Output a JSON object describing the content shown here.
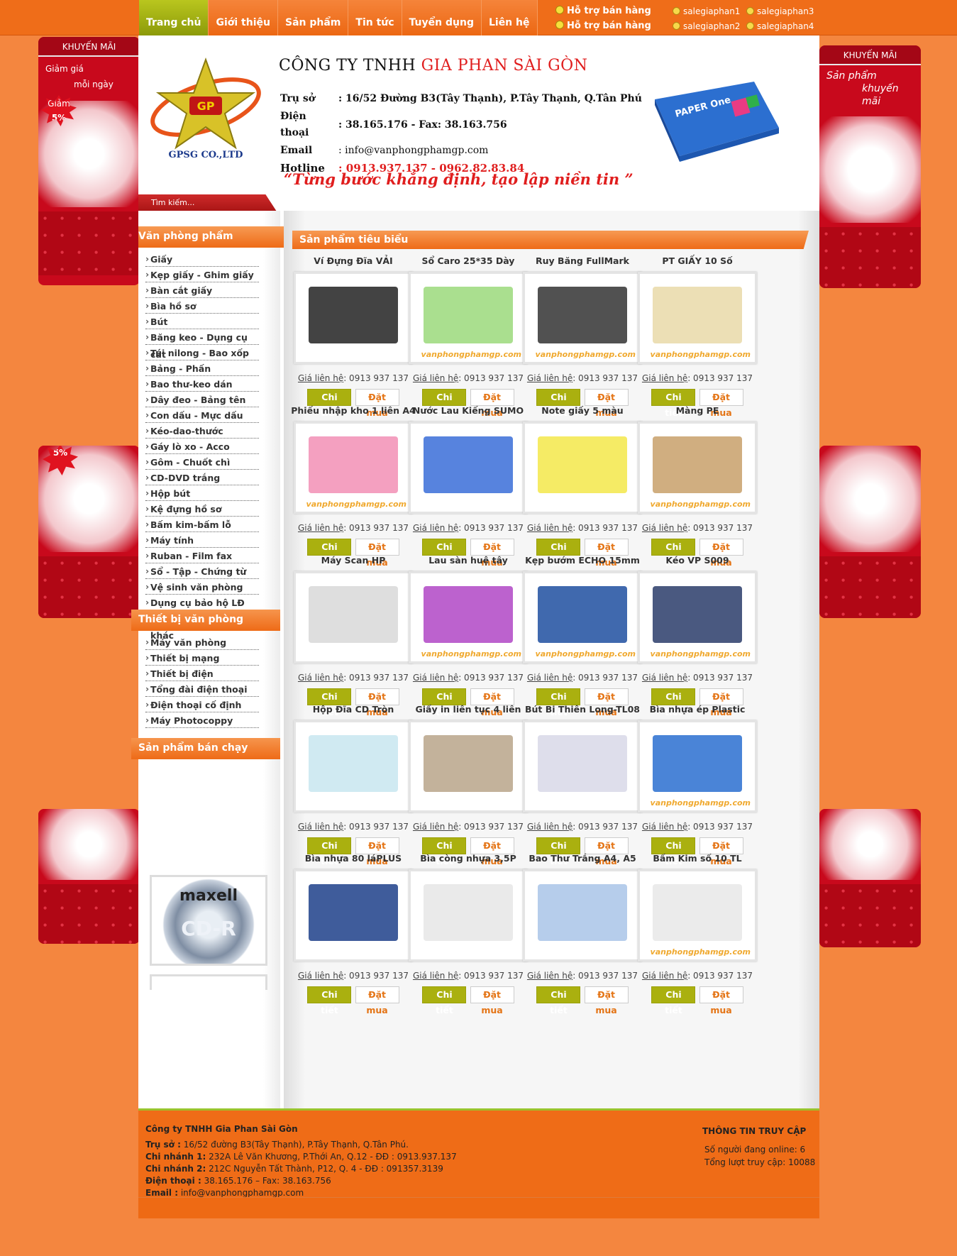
{
  "nav": {
    "items": [
      "Trang chủ",
      "Giới thiệu",
      "Sản phẩm",
      "Tin tức",
      "Tuyển dụng",
      "Liên hệ"
    ]
  },
  "support": {
    "label1": "Hỗ trợ bán hàng",
    "label2": "Hỗ trợ bán hàng",
    "accounts": [
      "salegiaphan1",
      "salegiaphan3",
      "salegiaphan2",
      "salegiaphan4"
    ]
  },
  "promo_left": {
    "title": "KHUYẾN MÃI",
    "text1": "Giảm giá",
    "text2": "mỗi ngày",
    "badge1": "Giảm",
    "badge2": "5%",
    "badge3": "5%"
  },
  "promo_right": {
    "title": "KHUYẾN MÃI",
    "text1": "Sản phẩm",
    "text2": "khuyến mãi"
  },
  "header": {
    "company_prefix": "CÔNG TY TNHH ",
    "company_name": "GIA PHAN SÀI GÒN",
    "addr_label": "Trụ sở",
    "addr": ": 16/52 Đường B3(Tây Thạnh), P.Tây Thạnh, Q.Tân Phú",
    "phone_label": "Điện thoại",
    "phone": ": 38.165.176 - Fax: 38.163.756",
    "email_label": "Email",
    "email": ": info@vanphongphamgp.com",
    "hotline_label": "Hotline",
    "hotline": ": 0913.937.137 - 0962.82.83.84",
    "slogan": "“Từng bước khẳng định, tạo lập niền tin ”",
    "logo_text": "GPSG CO.,LTD",
    "logo_initials": "GP",
    "paper_brand": "PAPER One",
    "search_placeholder": "Tìm kiếm..."
  },
  "sidebar": {
    "sec1": "Văn phòng phẩm",
    "sec1_items": [
      "Giấy",
      "Kẹp giấy - Ghim giấy",
      "Bàn cắt giấy",
      "Bìa hồ sơ",
      "Bút",
      "Băng keo - Dụng cụ cắt",
      "Túi nilong - Bao xốp",
      "Bảng - Phấn",
      "Bao thư-keo dán",
      "Dây đeo - Bảng tên",
      "Con dấu - Mực dấu",
      "Kéo-dao-thước",
      "Gáy lò xo - Acco",
      "Gôm - Chuốt chì",
      "CD-DVD trắng",
      "Hộp bút",
      "Kệ đựng hồ sơ",
      "Bấm kim-bấm lỗ",
      "Máy tính",
      "Ruban - Film fax",
      "Sổ - Tập - Chứng từ",
      "Vệ sinh văn phòng",
      "Dụng cụ bảo hộ LĐ",
      "Văn phòng phẩm khác"
    ],
    "sec2": "Thiết bị văn phòng",
    "sec2_items": [
      "Máy văn phòng",
      "Thiết bị mạng",
      "Thiết bị điện",
      "Tổng đài điện thoại",
      "Điện thoại cố định",
      "Máy Photocoppy"
    ],
    "sec3": "Sản phẩm bán chạy",
    "best_brand": "maxell",
    "best_label": "CD-R"
  },
  "main": {
    "title": "Sản phẩm tiêu biểu",
    "price_label": "Giá liên hệ",
    "price_value": ": 0913 937 137",
    "detail_btn": "Chi tiết",
    "order_btn": "Đặt mua",
    "watermark": "vanphongphamgp.com",
    "products": [
      "Ví Đựng Đĩa VẢI",
      "Sổ Caro 25*35 Dày",
      "Ruy Băng FullMark",
      "PT GIẤY 10 Số",
      "Phiếu nhập kho 1 liên A4",
      "Nước Lau Kiếng SUMO",
      "Note giấy 5 màu",
      "Màng PE",
      "Máy Scan HP",
      "Lau sàn huệ tây",
      "Kẹp bướm ECHO 15mm",
      "Kéo VP S009",
      "Hộp Đĩa CD Tròn",
      "Giấy in liên tục 4 liên",
      "Bút Bi Thiên Long-TL08",
      "Bìa nhựa ép Plastic",
      "Bìa nhựa 80 láPLUS",
      "Bìa còng nhựa 3,5P",
      "Bao Thư Trắng A4, A5",
      "Bấm Kim số 10 TL"
    ]
  },
  "footer": {
    "company": "Công ty TNHH Gia Phan Sài Gòn",
    "l1_label": "Trụ sở :",
    "l1": " 16/52 đường B3(Tây Thạnh), P.Tây Thạnh, Q.Tân Phú.",
    "l2_label": "Chi nhánh 1:",
    "l2": " 232A Lê Văn Khương, P.Thới An, Q.12 - ĐĐ : 0913.937.137",
    "l3_label": "Chi nhánh 2:",
    "l3": " 212C Nguyễn Tất Thành, P12, Q. 4 - ĐĐ : 091357.3139",
    "l4_label": "Điện thoại :",
    "l4": " 38.165.176 – Fax: 38.163.756",
    "l5_label": "Email :",
    "l5": " info@vanphongphamgp.com",
    "stats_title": "THÔNG TIN TRUY CẬP",
    "online": "Số người đang online: 6",
    "total": "Tổng lượt truy cập: 10088"
  },
  "colors": {
    "orange": "#ef6d19",
    "green": "#aab00f",
    "red": "#c8091c"
  }
}
